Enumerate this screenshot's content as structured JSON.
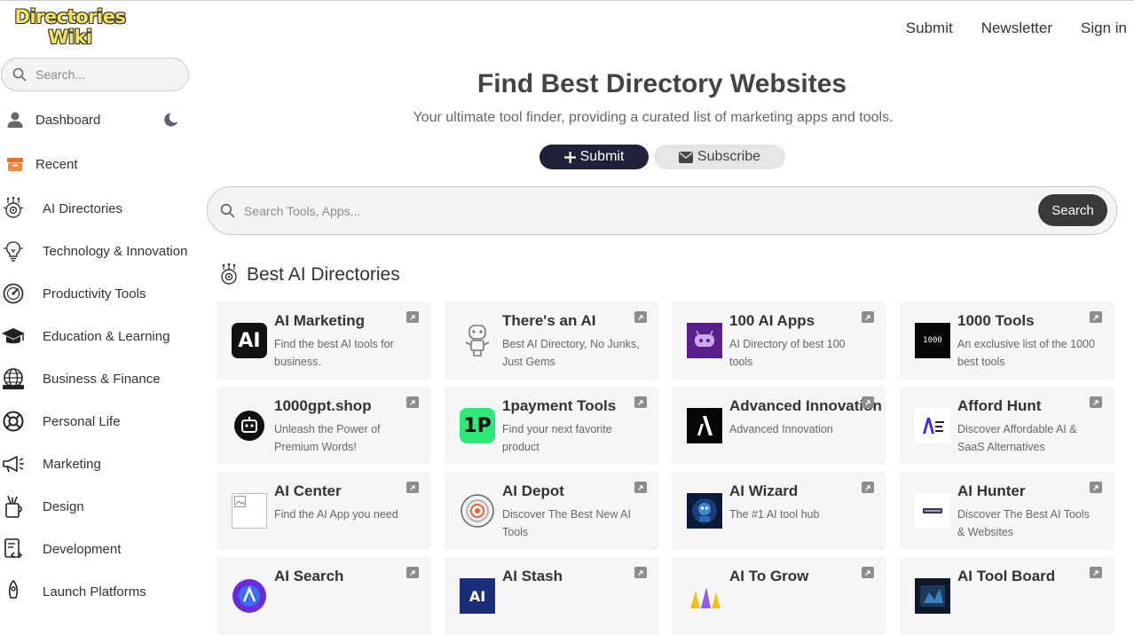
{
  "logo": {
    "line1": "Directories",
    "line2": "Wiki"
  },
  "topnav": {
    "submit": "Submit",
    "newsletter": "Newsletter",
    "signin": "Sign in"
  },
  "sidebar": {
    "search_placeholder": "Search...",
    "items": [
      {
        "label": "Dashboard",
        "icon": "user-icon"
      },
      {
        "label": "Recent",
        "icon": "box-icon"
      },
      {
        "label": "AI Directories",
        "icon": "ai-brain-icon"
      },
      {
        "label": "Technology & Innovation",
        "icon": "lightbulb-icon"
      },
      {
        "label": "Productivity Tools",
        "icon": "gauge-icon"
      },
      {
        "label": "Education & Learning",
        "icon": "graduation-cap-icon"
      },
      {
        "label": "Business & Finance",
        "icon": "globe-people-icon"
      },
      {
        "label": "Personal Life",
        "icon": "lifebuoy-icon"
      },
      {
        "label": "Marketing",
        "icon": "megaphone-icon"
      },
      {
        "label": "Design",
        "icon": "paint-cup-icon"
      },
      {
        "label": "Development",
        "icon": "code-doc-icon"
      },
      {
        "label": "Launch Platforms",
        "icon": "rocket-icon"
      }
    ]
  },
  "hero": {
    "title": "Find Best Directory Websites",
    "subtitle": "Your ultimate tool finder, providing a curated list of marketing apps and tools.",
    "submit_label": "Submit",
    "subscribe_label": "Subscribe"
  },
  "main_search": {
    "placeholder": "Search Tools, Apps...",
    "button": "Search"
  },
  "section": {
    "title": "Best AI Directories"
  },
  "cards": [
    {
      "name": "AI Marketing",
      "desc": "Find the best AI tools for business.",
      "thumb": "ai-logo-black"
    },
    {
      "name": "There's an AI",
      "desc": "Best AI Directory, No Junks, Just Gems",
      "thumb": "robot-outline"
    },
    {
      "name": "100 AI Apps",
      "desc": "AI Directory of best 100 tools",
      "thumb": "purple-robot"
    },
    {
      "name": "1000 Tools",
      "desc": "An exclusive list of the 1000 best tools",
      "thumb": "black-1000",
      "thumb_text": "1000"
    },
    {
      "name": "1000gpt.shop",
      "desc": "Unleash the Power of Premium Words!",
      "thumb": "black-circle-robot"
    },
    {
      "name": "1payment Tools",
      "desc": "Find your next favorite product",
      "thumb": "green-1p",
      "thumb_text": "1P"
    },
    {
      "name": "Advanced Innovation",
      "desc": "Advanced Innovation",
      "thumb": "black-a"
    },
    {
      "name": "Afford Hunt",
      "desc": "Discover Affordable AI & SaaS Alternatives",
      "thumb": "afford-hunt-logo"
    },
    {
      "name": "AI Center",
      "desc": "Find the AI App you need",
      "thumb": "broken-image"
    },
    {
      "name": "AI Depot",
      "desc": "Discover The Best New AI Tools",
      "thumb": "target-circle"
    },
    {
      "name": "AI Wizard",
      "desc": "The #1 AI tool hub",
      "thumb": "wizard-dark"
    },
    {
      "name": "AI Hunter",
      "desc": "Discover The Best AI Tools & Websites",
      "thumb": "hunter-small"
    },
    {
      "name": "AI Search",
      "desc": "",
      "thumb": "purple-circle"
    },
    {
      "name": "AI Stash",
      "desc": "",
      "thumb": "stash-blue",
      "thumb_text": "AI"
    },
    {
      "name": "AI To Grow",
      "desc": "",
      "thumb": "grow-yellow"
    },
    {
      "name": "AI Tool Board",
      "desc": "",
      "thumb": "toolboard-dark"
    }
  ],
  "colors": {
    "accent_dark": "#1e2138",
    "search_button": "#3a3a3a",
    "card_bg": "#f6f6f6"
  }
}
